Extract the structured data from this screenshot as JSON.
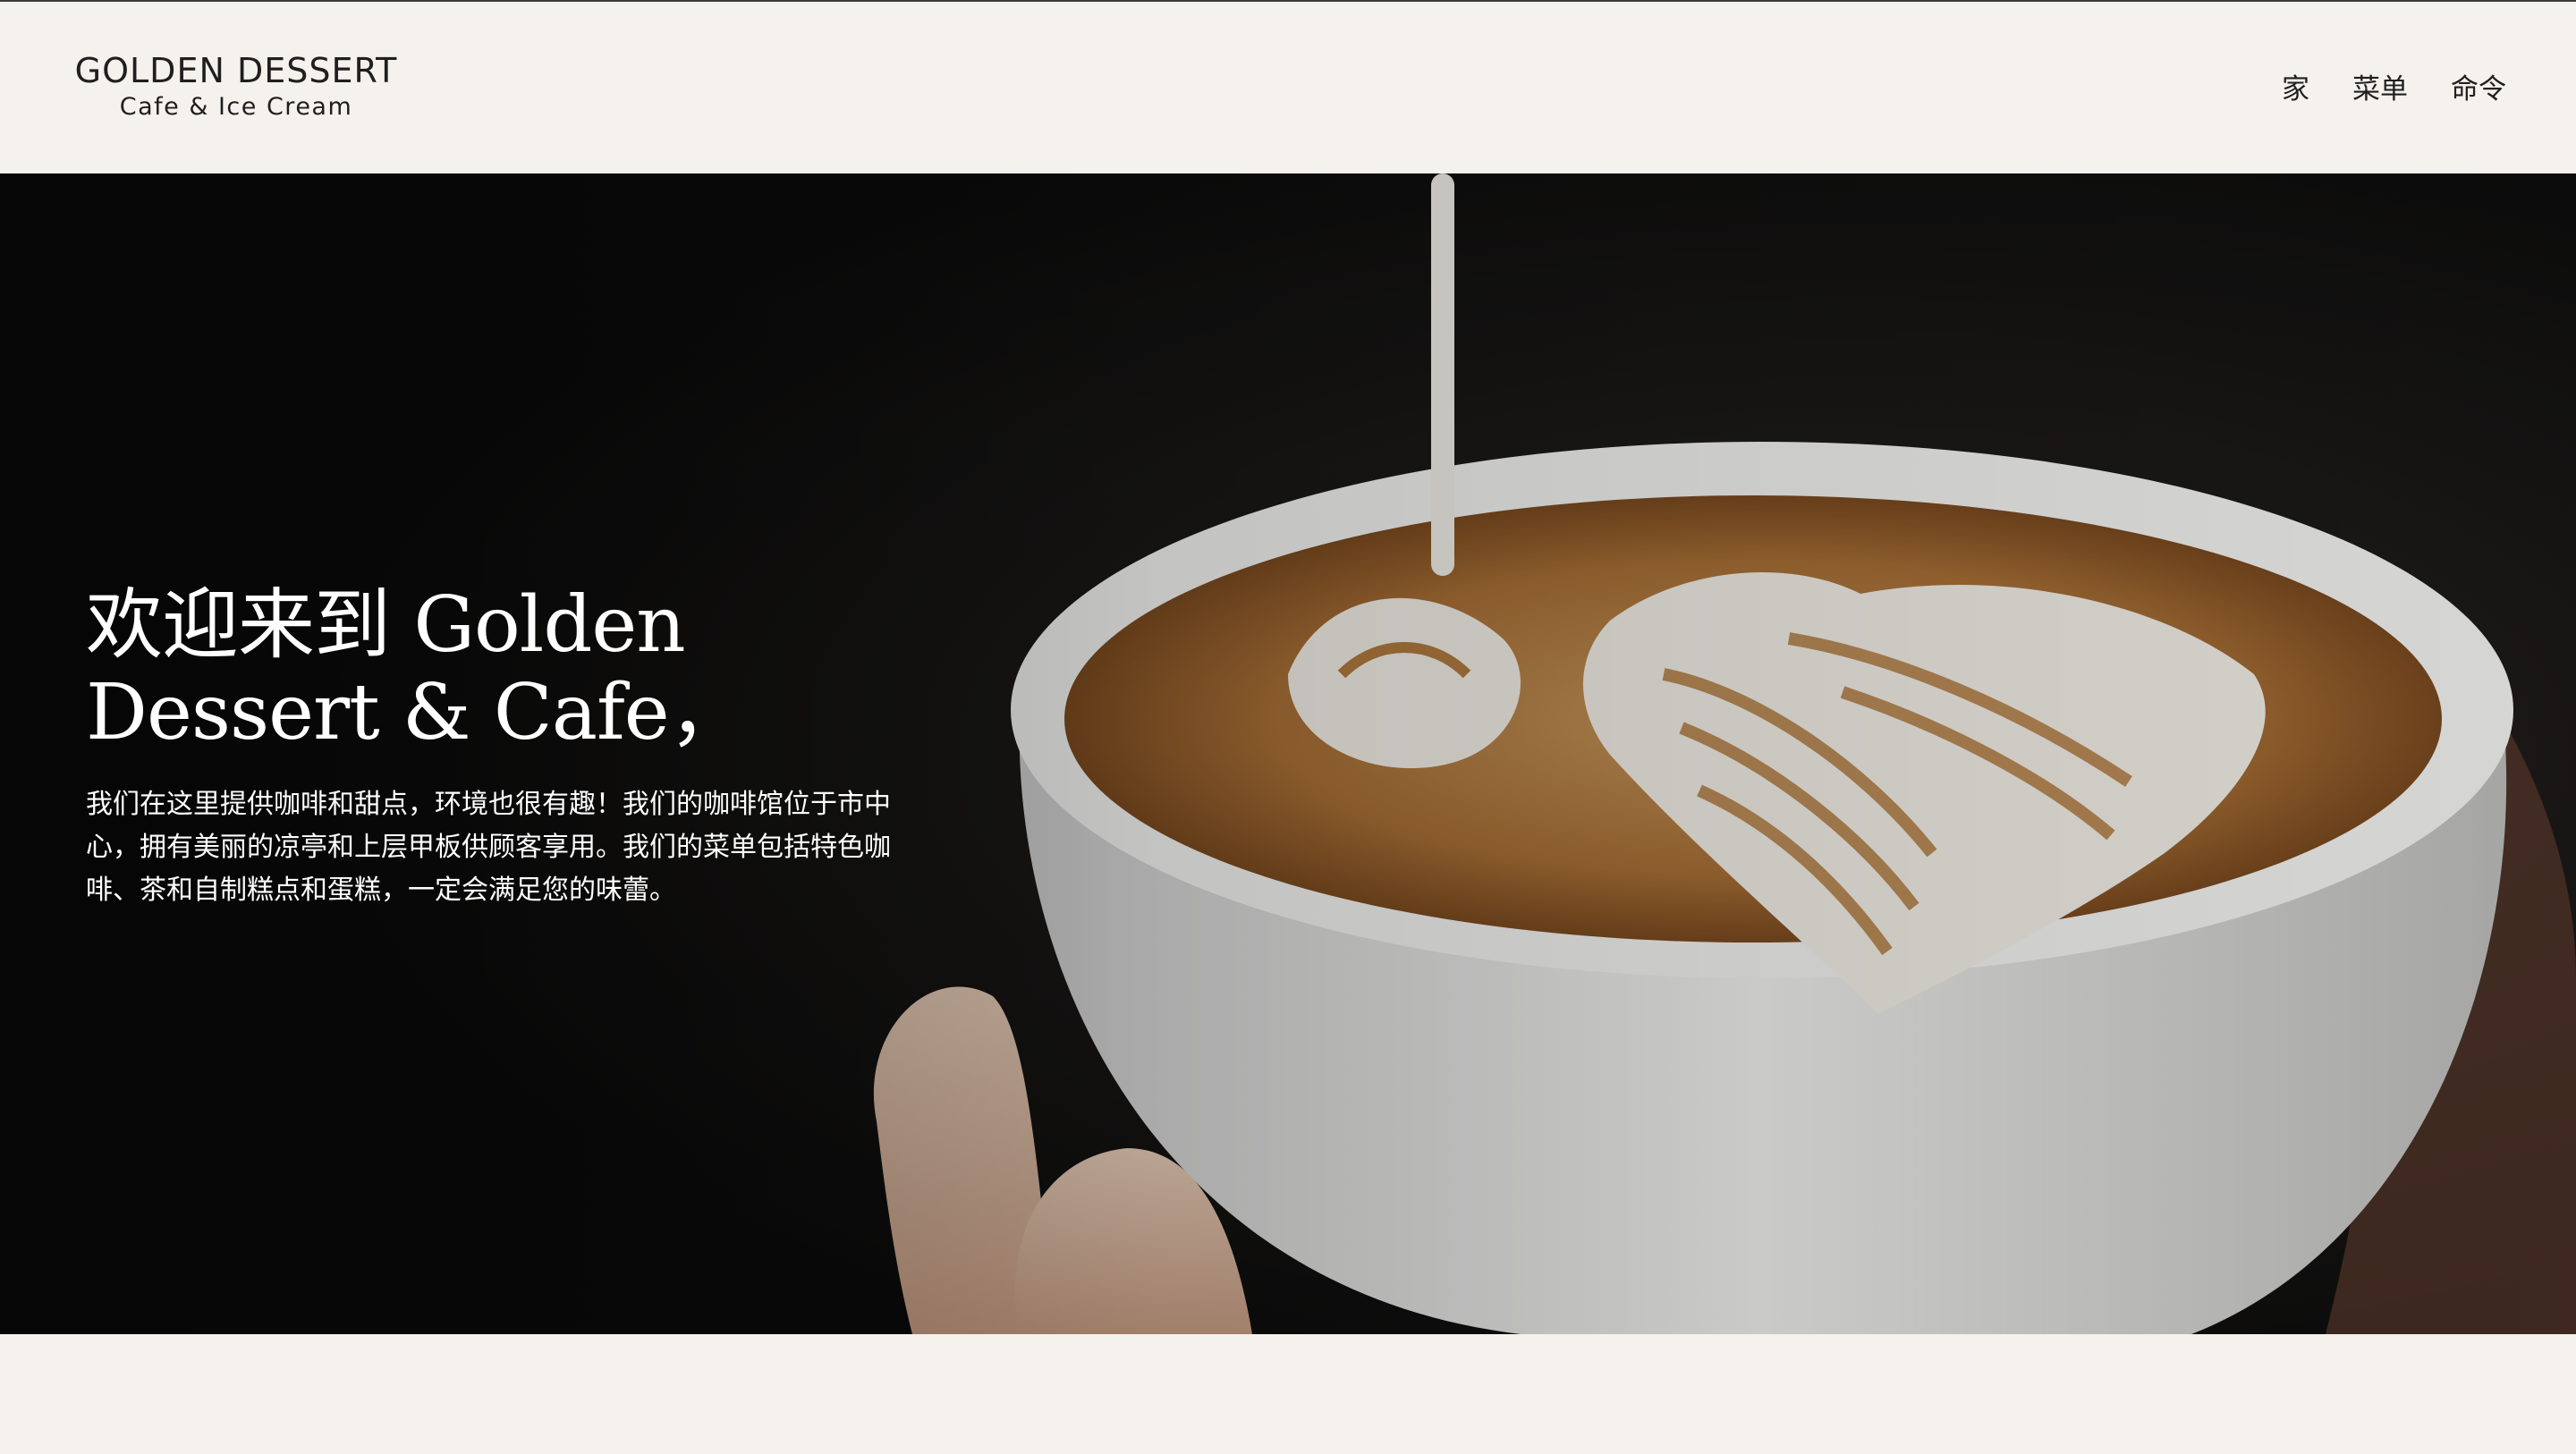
{
  "brand": {
    "title": "GOLDEN DESSERT",
    "subtitle": "Cafe & Ice Cream"
  },
  "nav": {
    "items": [
      {
        "label": "家"
      },
      {
        "label": "菜单"
      },
      {
        "label": "命令"
      }
    ]
  },
  "hero": {
    "title": "欢迎来到 Golden Dessert & Cafe，",
    "text": "我们在这里提供咖啡和甜点，环境也很有趣！我们的咖啡馆位于市中心，拥有美丽的凉亭和上层甲板供顾客享用。我们的菜单包括特色咖啡、茶和自制糕点和蛋糕，一定会满足您的味蕾。",
    "image": "latte-art-photo"
  },
  "colors": {
    "page_background": "#f5f1ec",
    "text_dark": "#1f1f1f",
    "hero_text": "#ffffff",
    "coffee": "#b07a3e"
  }
}
